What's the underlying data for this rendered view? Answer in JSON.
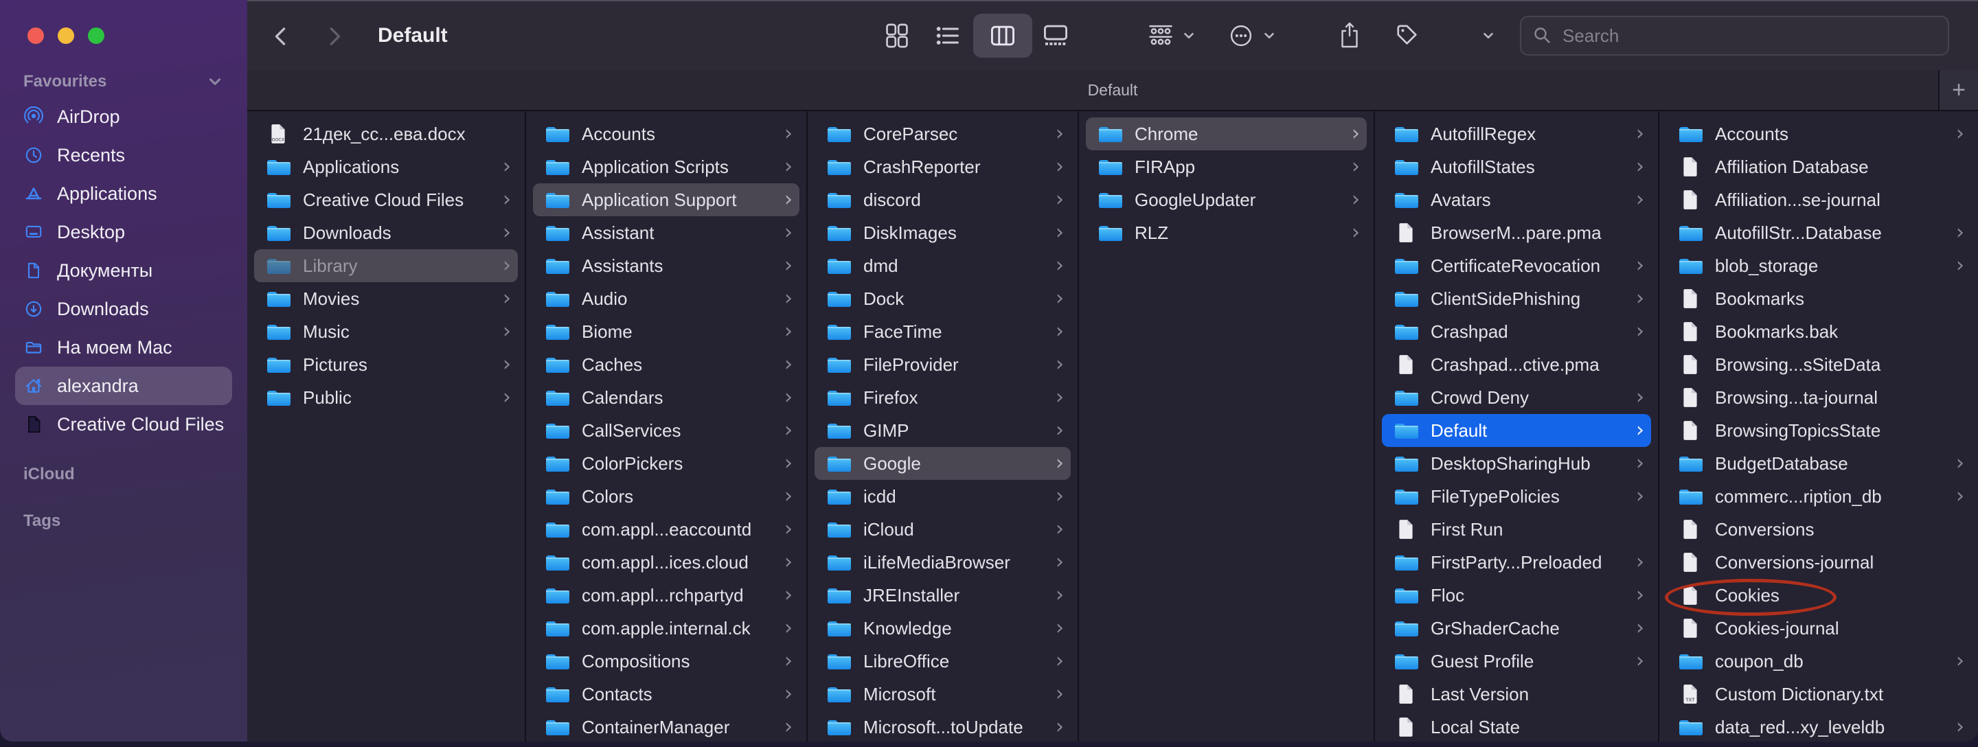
{
  "window": {
    "title": "Default",
    "path_label": "Default",
    "add_label": "+"
  },
  "toolbar": {
    "search_placeholder": "Search",
    "icons": [
      "back",
      "forward",
      "grid-view",
      "list-view",
      "column-view",
      "gallery-view",
      "group-by",
      "more-actions",
      "share",
      "tag",
      "chevron-down",
      "search"
    ]
  },
  "ui": {
    "row_chevron": "›"
  },
  "sidebar": {
    "sections": [
      {
        "header": "Favourites",
        "chevron": true,
        "items": [
          {
            "label": "AirDrop",
            "icon": "airdrop"
          },
          {
            "label": "Recents",
            "icon": "clock"
          },
          {
            "label": "Applications",
            "icon": "appstore"
          },
          {
            "label": "Desktop",
            "icon": "desktop"
          },
          {
            "label": "Документы",
            "icon": "document"
          },
          {
            "label": "Downloads",
            "icon": "download"
          },
          {
            "label": "На моем Mac",
            "icon": "folder"
          },
          {
            "label": "alexandra",
            "icon": "home",
            "selected": true
          },
          {
            "label": "Creative Cloud Files",
            "icon": "darkdoc"
          }
        ]
      },
      {
        "header": "iCloud",
        "chevron": false,
        "items": []
      },
      {
        "header": "Tags",
        "chevron": false,
        "items": []
      }
    ]
  },
  "columns": [
    {
      "items": [
        {
          "name": "21дек_сс...ева.docx",
          "kind": "docx"
        },
        {
          "name": "Applications",
          "kind": "folder",
          "chevron": true
        },
        {
          "name": "Creative Cloud Files",
          "kind": "folder",
          "chevron": true
        },
        {
          "name": "Downloads",
          "kind": "folder",
          "chevron": true
        },
        {
          "name": "Library",
          "kind": "folder",
          "chevron": true,
          "selection": "muted"
        },
        {
          "name": "Movies",
          "kind": "folder",
          "chevron": true
        },
        {
          "name": "Music",
          "kind": "folder",
          "chevron": true
        },
        {
          "name": "Pictures",
          "kind": "folder",
          "chevron": true
        },
        {
          "name": "Public",
          "kind": "folder",
          "chevron": true
        }
      ]
    },
    {
      "items": [
        {
          "name": "Accounts",
          "kind": "folder",
          "chevron": true
        },
        {
          "name": "Application Scripts",
          "kind": "folder",
          "chevron": true
        },
        {
          "name": "Application Support",
          "kind": "folder",
          "chevron": true,
          "selection": "gray"
        },
        {
          "name": "Assistant",
          "kind": "folder",
          "chevron": true
        },
        {
          "name": "Assistants",
          "kind": "folder",
          "chevron": true
        },
        {
          "name": "Audio",
          "kind": "folder",
          "chevron": true
        },
        {
          "name": "Biome",
          "kind": "folder",
          "chevron": true
        },
        {
          "name": "Caches",
          "kind": "folder",
          "chevron": true
        },
        {
          "name": "Calendars",
          "kind": "folder",
          "chevron": true
        },
        {
          "name": "CallServices",
          "kind": "folder",
          "chevron": true
        },
        {
          "name": "ColorPickers",
          "kind": "folder",
          "chevron": true
        },
        {
          "name": "Colors",
          "kind": "folder",
          "chevron": true
        },
        {
          "name": "com.appl...eaccountd",
          "kind": "folder",
          "chevron": true
        },
        {
          "name": "com.appl...ices.cloud",
          "kind": "folder",
          "chevron": true
        },
        {
          "name": "com.appl...rchpartyd",
          "kind": "folder",
          "chevron": true
        },
        {
          "name": "com.apple.internal.ck",
          "kind": "folder",
          "chevron": true
        },
        {
          "name": "Compositions",
          "kind": "folder",
          "chevron": true
        },
        {
          "name": "Contacts",
          "kind": "folder",
          "chevron": true
        },
        {
          "name": "ContainerManager",
          "kind": "folder",
          "chevron": true
        }
      ]
    },
    {
      "items": [
        {
          "name": "CoreParsec",
          "kind": "folder",
          "chevron": true
        },
        {
          "name": "CrashReporter",
          "kind": "folder",
          "chevron": true
        },
        {
          "name": "discord",
          "kind": "folder",
          "chevron": true
        },
        {
          "name": "DiskImages",
          "kind": "folder",
          "chevron": true
        },
        {
          "name": "dmd",
          "kind": "folder",
          "chevron": true
        },
        {
          "name": "Dock",
          "kind": "folder",
          "chevron": true
        },
        {
          "name": "FaceTime",
          "kind": "folder",
          "chevron": true
        },
        {
          "name": "FileProvider",
          "kind": "folder",
          "chevron": true
        },
        {
          "name": "Firefox",
          "kind": "folder",
          "chevron": true
        },
        {
          "name": "GIMP",
          "kind": "folder",
          "chevron": true
        },
        {
          "name": "Google",
          "kind": "folder",
          "chevron": true,
          "selection": "gray"
        },
        {
          "name": "icdd",
          "kind": "folder",
          "chevron": true
        },
        {
          "name": "iCloud",
          "kind": "folder",
          "chevron": true
        },
        {
          "name": "iLifeMediaBrowser",
          "kind": "folder",
          "chevron": true
        },
        {
          "name": "JREInstaller",
          "kind": "folder",
          "chevron": true
        },
        {
          "name": "Knowledge",
          "kind": "folder",
          "chevron": true
        },
        {
          "name": "LibreOffice",
          "kind": "folder",
          "chevron": true
        },
        {
          "name": "Microsoft",
          "kind": "folder",
          "chevron": true
        },
        {
          "name": "Microsoft...toUpdate",
          "kind": "folder",
          "chevron": true
        }
      ]
    },
    {
      "items": [
        {
          "name": "Chrome",
          "kind": "folder",
          "chevron": true,
          "selection": "gray"
        },
        {
          "name": "FIRApp",
          "kind": "folder",
          "chevron": true
        },
        {
          "name": "GoogleUpdater",
          "kind": "folder",
          "chevron": true
        },
        {
          "name": "RLZ",
          "kind": "folder",
          "chevron": true
        }
      ]
    },
    {
      "items": [
        {
          "name": "AutofillRegex",
          "kind": "folder",
          "chevron": true
        },
        {
          "name": "AutofillStates",
          "kind": "folder",
          "chevron": true
        },
        {
          "name": "Avatars",
          "kind": "folder",
          "chevron": true
        },
        {
          "name": "BrowserM...pare.pma",
          "kind": "file"
        },
        {
          "name": "CertificateRevocation",
          "kind": "folder",
          "chevron": true
        },
        {
          "name": "ClientSidePhishing",
          "kind": "folder",
          "chevron": true
        },
        {
          "name": "Crashpad",
          "kind": "folder",
          "chevron": true
        },
        {
          "name": "Crashpad...ctive.pma",
          "kind": "file"
        },
        {
          "name": "Crowd Deny",
          "kind": "folder",
          "chevron": true
        },
        {
          "name": "Default",
          "kind": "folder",
          "chevron": true,
          "selection": "blue"
        },
        {
          "name": "DesktopSharingHub",
          "kind": "folder",
          "chevron": true
        },
        {
          "name": "FileTypePolicies",
          "kind": "folder",
          "chevron": true
        },
        {
          "name": "First Run",
          "kind": "file"
        },
        {
          "name": "FirstParty...Preloaded",
          "kind": "folder",
          "chevron": true
        },
        {
          "name": "Floc",
          "kind": "folder",
          "chevron": true
        },
        {
          "name": "GrShaderCache",
          "kind": "folder",
          "chevron": true
        },
        {
          "name": "Guest Profile",
          "kind": "folder",
          "chevron": true
        },
        {
          "name": "Last Version",
          "kind": "file"
        },
        {
          "name": "Local State",
          "kind": "file"
        }
      ]
    },
    {
      "items": [
        {
          "name": "Accounts",
          "kind": "folder",
          "chevron": true
        },
        {
          "name": "Affiliation Database",
          "kind": "file"
        },
        {
          "name": "Affiliation...se-journal",
          "kind": "file"
        },
        {
          "name": "AutofillStr...Database",
          "kind": "folder",
          "chevron": true
        },
        {
          "name": "blob_storage",
          "kind": "folder",
          "chevron": true
        },
        {
          "name": "Bookmarks",
          "kind": "file"
        },
        {
          "name": "Bookmarks.bak",
          "kind": "file"
        },
        {
          "name": "Browsing...sSiteData",
          "kind": "file"
        },
        {
          "name": "Browsing...ta-journal",
          "kind": "file"
        },
        {
          "name": "BrowsingTopicsState",
          "kind": "file"
        },
        {
          "name": "BudgetDatabase",
          "kind": "folder",
          "chevron": true
        },
        {
          "name": "commerc...ription_db",
          "kind": "folder",
          "chevron": true
        },
        {
          "name": "Conversions",
          "kind": "file"
        },
        {
          "name": "Conversions-journal",
          "kind": "file"
        },
        {
          "name": "Cookies",
          "kind": "file",
          "annotated": true
        },
        {
          "name": "Cookies-journal",
          "kind": "file"
        },
        {
          "name": "coupon_db",
          "kind": "folder",
          "chevron": true
        },
        {
          "name": "Custom Dictionary.txt",
          "kind": "txt"
        },
        {
          "name": "data_red...xy_leveldb",
          "kind": "folder",
          "chevron": true
        }
      ]
    }
  ],
  "annotation": {
    "shape": "ellipse",
    "color": "#b0301c",
    "target": "Cookies"
  }
}
